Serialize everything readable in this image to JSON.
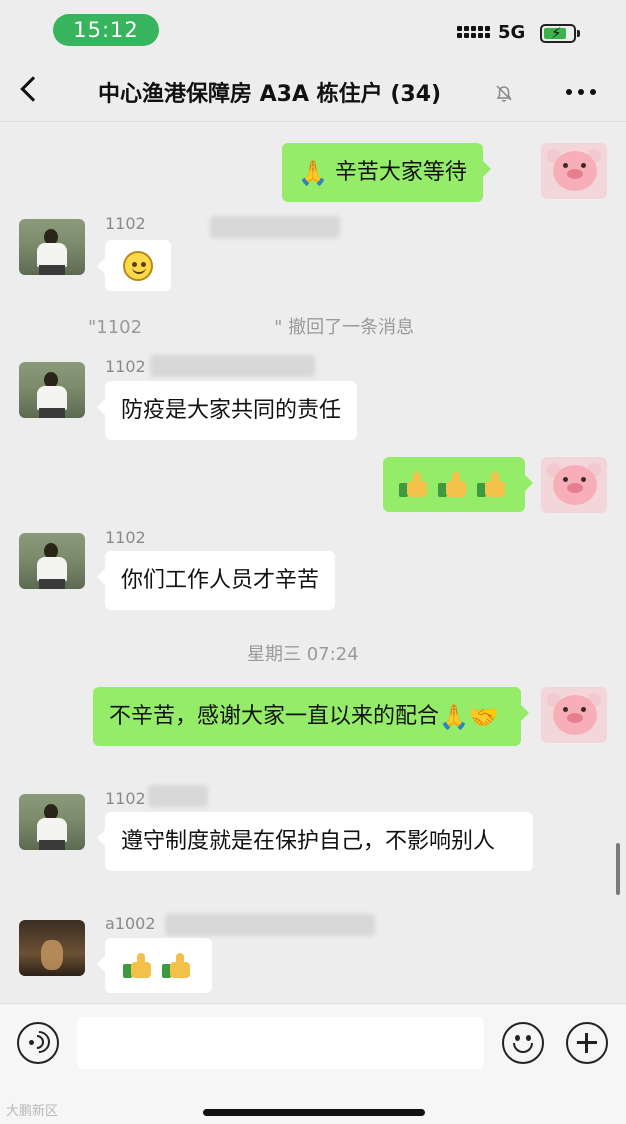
{
  "status_bar": {
    "time": "15:12",
    "network": "5G"
  },
  "nav": {
    "title": "中心渔港保障房 A3A 栋住户 (34)"
  },
  "messages": {
    "m1": {
      "text": "辛苦大家等待"
    },
    "m2": {
      "nick": "1102"
    },
    "recall": {
      "prefix": "\"1102",
      "suffix": "\" 撤回了一条消息"
    },
    "m4": {
      "nick": "1102",
      "text": "防疫是大家共同的责任"
    },
    "m6": {
      "nick": "1102",
      "text": "你们工作人员才辛苦"
    },
    "timestamp": "星期三 07:24",
    "m7": {
      "text": "不辛苦，感谢大家一直以来的配合"
    },
    "m8": {
      "nick": "1102",
      "text": "遵守制度就是在保护自己，不影响别人"
    },
    "m9": {
      "nick": "a1002"
    }
  },
  "icons": {
    "back": "back-arrow-icon",
    "mute": "mute-bell-icon",
    "more": "more-icon",
    "voice": "voice-icon",
    "emoji": "emoji-icon",
    "plus": "plus-icon"
  },
  "input": {
    "value": ""
  },
  "watermark": "大鹏新区",
  "colors": {
    "time_pill": "#38b35e",
    "bubble_self": "#95ec69",
    "bubble_other": "#ffffff",
    "background": "#ededed"
  }
}
